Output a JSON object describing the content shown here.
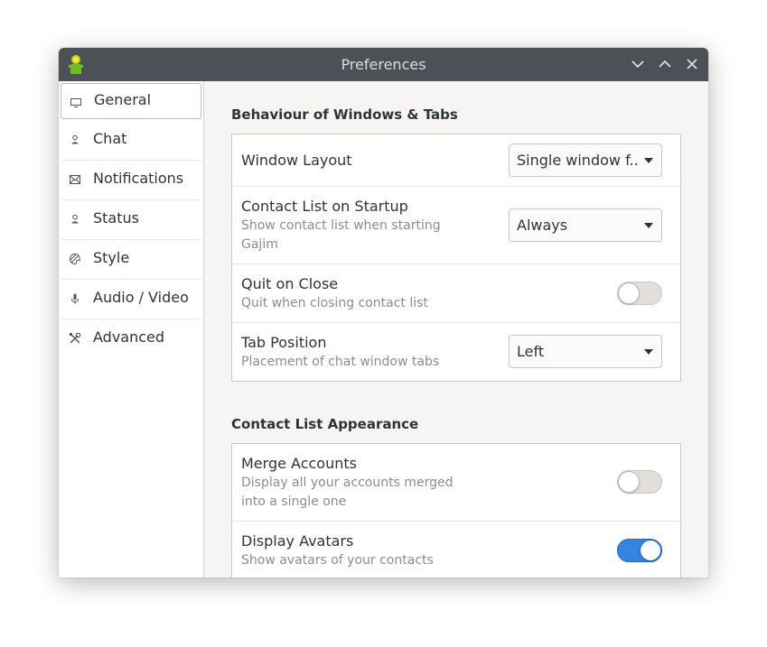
{
  "window": {
    "title": "Preferences",
    "accent_color": "#3584e4",
    "titlebar_color": "#4b5157"
  },
  "titlebar_buttons": {
    "minimize_icon": "chevron-down-icon",
    "maximize_icon": "chevron-up-icon",
    "close_icon": "close-icon"
  },
  "sidebar": {
    "items": [
      {
        "label": "General",
        "icon": "monitor-icon",
        "selected": true
      },
      {
        "label": "Chat",
        "icon": "person-icon"
      },
      {
        "label": "Notifications",
        "icon": "envelope-icon"
      },
      {
        "label": "Status",
        "icon": "person-icon"
      },
      {
        "label": "Style",
        "icon": "palette-icon"
      },
      {
        "label": "Audio / Video",
        "icon": "microphone-icon"
      },
      {
        "label": "Advanced",
        "icon": "tools-icon"
      }
    ]
  },
  "sections": {
    "windows_tabs": {
      "title": "Behaviour of Windows & Tabs",
      "window_layout": {
        "title": "Window Layout",
        "value": "Single window f..."
      },
      "contact_list_startup": {
        "title": "Contact List on Startup",
        "subtitle": "Show contact list when starting Gajim",
        "value": "Always"
      },
      "quit_on_close": {
        "title": "Quit on Close",
        "subtitle": "Quit when closing contact list",
        "enabled": false
      },
      "tab_position": {
        "title": "Tab Position",
        "subtitle": "Placement of chat window tabs",
        "value": "Left"
      }
    },
    "contact_list_appearance": {
      "title": "Contact List Appearance",
      "merge_accounts": {
        "title": "Merge Accounts",
        "subtitle": "Display all your accounts merged into a single one",
        "enabled": false
      },
      "display_avatars": {
        "title": "Display Avatars",
        "subtitle": "Show avatars of your contacts",
        "enabled": true
      }
    }
  }
}
